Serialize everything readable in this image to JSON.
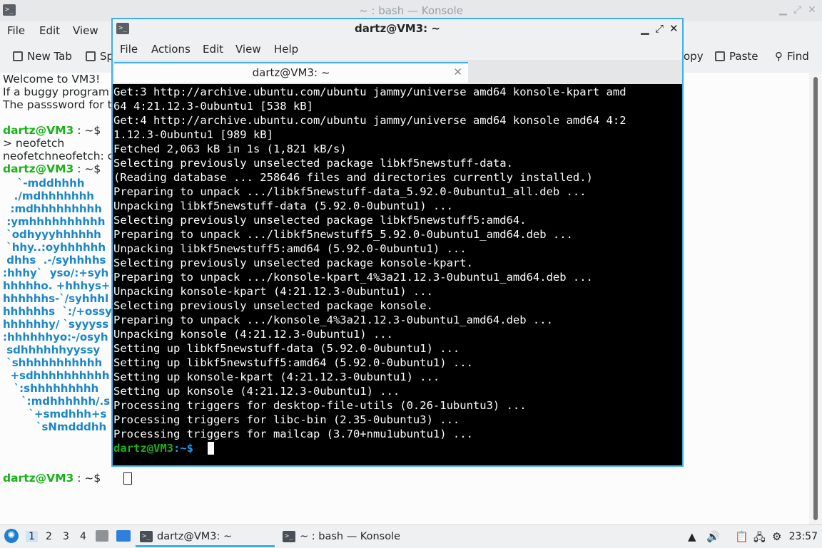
{
  "bg_window": {
    "title": "~ : bash — Konsole",
    "menu": [
      "File",
      "Edit",
      "View"
    ],
    "toolbar": {
      "new_tab": "New Tab",
      "split": "Sp",
      "copy": "opy",
      "paste": "Paste",
      "find": "Find"
    },
    "lines": [
      "Welcome to VM3!",
      "If a buggy program",
      "The passsword for t"
    ],
    "prompt": {
      "user": "dartz@VM3",
      "path": " : ~$ "
    },
    "cmd1": "> neofetch",
    "cmd2": "neofetchneofetch: c",
    "art": [
      "    `-mddhhhh",
      "   ./mdhhhhhhh",
      "  :mdhhhhhhhhh",
      " :ymhhhhhhhhhh",
      " `odhyyyhhhhhh",
      " `hhy..:oyhhhhhh",
      " dhhs  .-/syhhhhs",
      ":hhhy`  yso/:+syh",
      "hhhhho. +hhhys+",
      "hhhhhhs-`/syhhhl",
      "hhhhhhs  `:/+ossy",
      "hhhhhhy/ `syyyss",
      ":hhhhhhyo:-/osyh",
      " sdhhhhhhyyssy",
      " `shhhhhhhhhhh",
      "  +sdhhhhhhhhhh",
      "   `:shhhhhhhhh",
      "     `:mdhhhhhh/.s",
      "       `+smdhhh+s",
      "         `sNmdddhh"
    ]
  },
  "fg_window": {
    "title": "dartz@VM3: ~",
    "menu": [
      "File",
      "Actions",
      "Edit",
      "View",
      "Help"
    ],
    "tab_title": "dartz@VM3: ~",
    "lines": [
      "Get:3 http://archive.ubuntu.com/ubuntu jammy/universe amd64 konsole-kpart amd",
      "64 4:21.12.3-0ubuntu1 [538 kB]",
      "Get:4 http://archive.ubuntu.com/ubuntu jammy/universe amd64 konsole amd64 4:2",
      "1.12.3-0ubuntu1 [989 kB]",
      "Fetched 2,063 kB in 1s (1,821 kB/s)",
      "Selecting previously unselected package libkf5newstuff-data.",
      "(Reading database ... 258646 files and directories currently installed.)",
      "Preparing to unpack .../libkf5newstuff-data_5.92.0-0ubuntu1_all.deb ...",
      "Unpacking libkf5newstuff-data (5.92.0-0ubuntu1) ...",
      "Selecting previously unselected package libkf5newstuff5:amd64.",
      "Preparing to unpack .../libkf5newstuff5_5.92.0-0ubuntu1_amd64.deb ...",
      "Unpacking libkf5newstuff5:amd64 (5.92.0-0ubuntu1) ...",
      "Selecting previously unselected package konsole-kpart.",
      "Preparing to unpack .../konsole-kpart_4%3a21.12.3-0ubuntu1_amd64.deb ...",
      "Unpacking konsole-kpart (4:21.12.3-0ubuntu1) ...",
      "Selecting previously unselected package konsole.",
      "Preparing to unpack .../konsole_4%3a21.12.3-0ubuntu1_amd64.deb ...",
      "Unpacking konsole (4:21.12.3-0ubuntu1) ...",
      "Setting up libkf5newstuff-data (5.92.0-0ubuntu1) ...",
      "Setting up libkf5newstuff5:amd64 (5.92.0-0ubuntu1) ...",
      "Setting up konsole-kpart (4:21.12.3-0ubuntu1) ...",
      "Setting up konsole (4:21.12.3-0ubuntu1) ...",
      "Processing triggers for desktop-file-utils (0.26-1ubuntu3) ...",
      "Processing triggers for libc-bin (2.35-0ubuntu3) ...",
      "Processing triggers for mailcap (3.70+nmu1ubuntu1) ..."
    ],
    "prompt": {
      "user": "dartz@VM3",
      "path": ":~$"
    }
  },
  "taskbar": {
    "workspaces": [
      "1",
      "2",
      "3",
      "4"
    ],
    "tasks": [
      "dartz@VM3: ~",
      "~ : bash — Konsole"
    ],
    "clock": "23:57"
  },
  "colors": {
    "accent": "#3daee9",
    "prompt_green": "#18b218",
    "prompt_blue": "#1d99f3",
    "art_blue": "#1a86c8"
  }
}
